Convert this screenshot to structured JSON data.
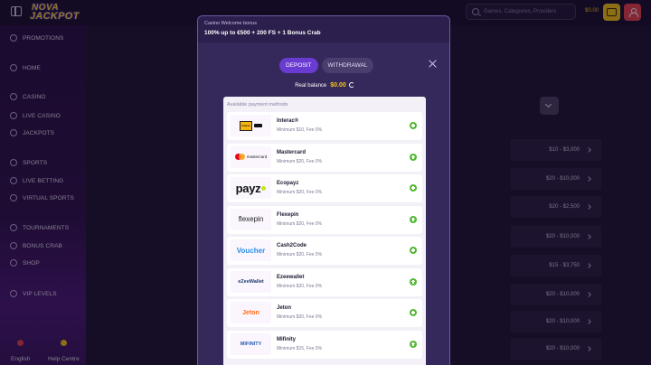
{
  "header": {
    "logo_line1": "NOVA",
    "logo_line2": "JACKPOT",
    "search_placeholder": "Games, Categories, Providers",
    "balance": "$0.00"
  },
  "sidebar": {
    "items": [
      {
        "label": "PROMOTIONS",
        "icon": "gift-icon"
      },
      {
        "label": "HOME",
        "icon": "home-icon"
      },
      {
        "label": "CASINO",
        "icon": "casino-icon"
      },
      {
        "label": "LIVE CASINO",
        "icon": "live-casino-icon"
      },
      {
        "label": "JACKPOTS",
        "icon": "jackpot-icon"
      },
      {
        "label": "SPORTS",
        "icon": "sports-icon"
      },
      {
        "label": "LIVE BETTING",
        "icon": "live-betting-icon"
      },
      {
        "label": "VIRTUAL SPORTS",
        "icon": "virtual-sports-icon"
      },
      {
        "label": "TOURNAMENTS",
        "icon": "trophy-icon"
      },
      {
        "label": "BONUS CRAB",
        "icon": "crab-icon"
      },
      {
        "label": "SHOP",
        "icon": "shop-icon"
      },
      {
        "label": "VIP LEVELS",
        "icon": "vip-icon"
      }
    ],
    "footer": {
      "language": "English",
      "help": "Help Centre"
    }
  },
  "background_rows": [
    "$10 - $3,000",
    "$20 - $10,000",
    "$20 - $2,500",
    "$20 - $10,000",
    "$15 - $3,750",
    "$20 - $10,000",
    "$20 - $10,000",
    "$20 - $10,000"
  ],
  "modal": {
    "bonus_title": "Casino Welcome bonus",
    "bonus_desc": "100% up to €500 + 200 FS + 1 Bonus Crab",
    "tabs": [
      "DEPOSIT",
      "WITHDRAWAL"
    ],
    "real_balance_label": "Real balance",
    "real_balance_value": "$0.00",
    "methods_title": "Available payment methods",
    "methods": [
      {
        "name": "Interac®",
        "limit": "Minimum $10, Fee 0%",
        "logo": "interac"
      },
      {
        "name": "Mastercard",
        "limit": "Minimum $20, Fee 0%",
        "logo": "mastercard"
      },
      {
        "name": "Ecopayz",
        "limit": "Minimum $20, Fee 0%",
        "logo": "payz"
      },
      {
        "name": "Flexepin",
        "limit": "Minimum $20, Fee 0%",
        "logo": "flexepin"
      },
      {
        "name": "Cash2Code",
        "limit": "Minimum $20, Fee 0%",
        "logo": "cash2code"
      },
      {
        "name": "Ezeewallet",
        "limit": "Minimum $20, Fee 0%",
        "logo": "ezeewallet"
      },
      {
        "name": "Jeton",
        "limit": "Minimum $20, Fee 0%",
        "logo": "jeton"
      },
      {
        "name": "Mifinity",
        "limit": "Minimum $15, Fee 0%",
        "logo": "mifinity"
      }
    ],
    "logo_text": {
      "interac": "Interac",
      "mastercard": "mastercard",
      "payz": "payz",
      "flexepin": "flexepin",
      "cash2code": "Voucher",
      "ezeewallet": "eZeeWallet",
      "jeton": "Jeton",
      "mifinity": "MIFINITY"
    }
  }
}
